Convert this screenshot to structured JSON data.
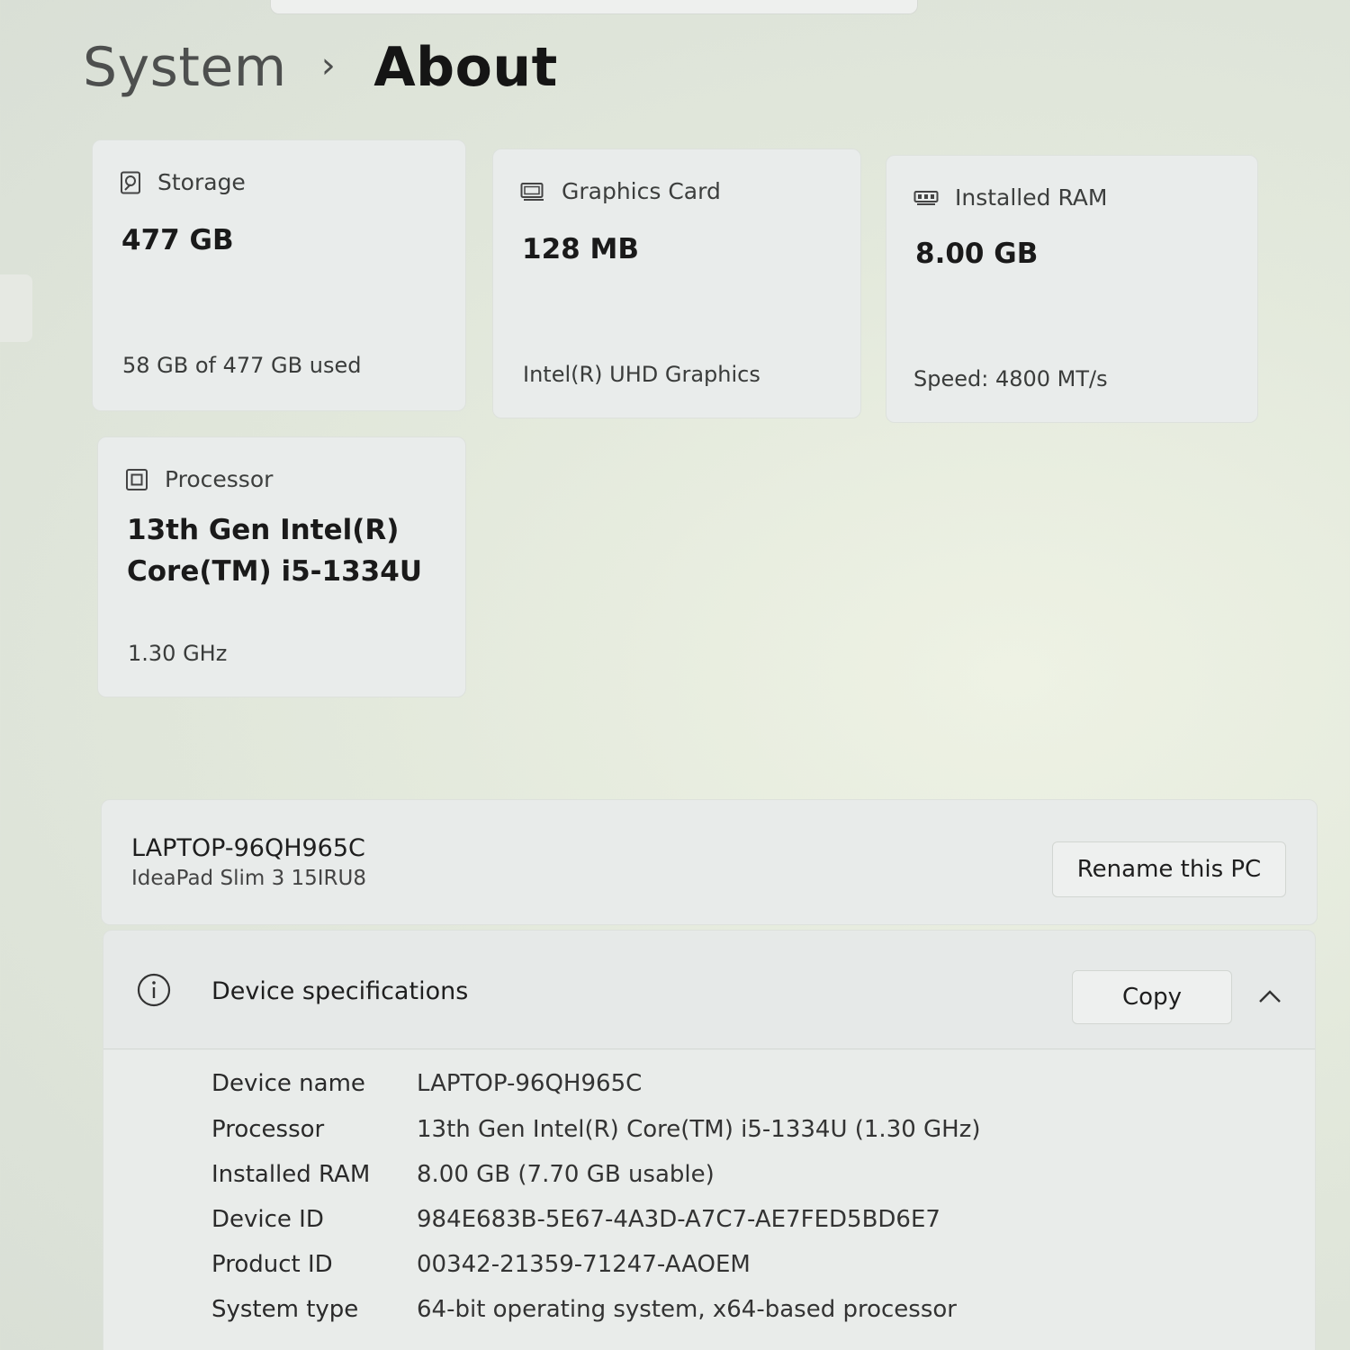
{
  "breadcrumb": {
    "parent": "System",
    "separator": "›",
    "current": "About"
  },
  "cards": {
    "storage": {
      "icon": "storage-icon",
      "label": "Storage",
      "value": "477 GB",
      "detail": "58 GB of 477 GB used"
    },
    "graphics": {
      "icon": "graphics-card-icon",
      "label": "Graphics Card",
      "value": "128 MB",
      "detail": "Intel(R) UHD Graphics"
    },
    "ram": {
      "icon": "ram-icon",
      "label": "Installed RAM",
      "value": "8.00 GB",
      "detail": "Speed: 4800 MT/s"
    },
    "processor": {
      "icon": "processor-icon",
      "label": "Processor",
      "value_line1": "13th Gen Intel(R)",
      "value_line2": "Core(TM) i5-1334U",
      "detail": "1.30 GHz"
    }
  },
  "pc": {
    "name": "LAPTOP-96QH965C",
    "model": "IdeaPad Slim 3 15IRU8",
    "rename_label": "Rename this PC"
  },
  "specs": {
    "title": "Device specifications",
    "copy_label": "Copy",
    "rows": [
      {
        "key": "Device name",
        "value": "LAPTOP-96QH965C"
      },
      {
        "key": "Processor",
        "value": "13th Gen Intel(R) Core(TM) i5-1334U (1.30 GHz)"
      },
      {
        "key": "Installed RAM",
        "value": "8.00 GB (7.70 GB usable)"
      },
      {
        "key": "Device ID",
        "value": "984E683B-5E67-4A3D-A7C7-AE7FED5BD6E7"
      },
      {
        "key": "Product ID",
        "value": "00342-21359-71247-AAOEM"
      },
      {
        "key": "System type",
        "value": "64-bit operating system, x64-based processor"
      }
    ]
  },
  "colors": {
    "background": "#e3e9dc",
    "card": "#e9eceb",
    "text": "#1b1b1b"
  }
}
